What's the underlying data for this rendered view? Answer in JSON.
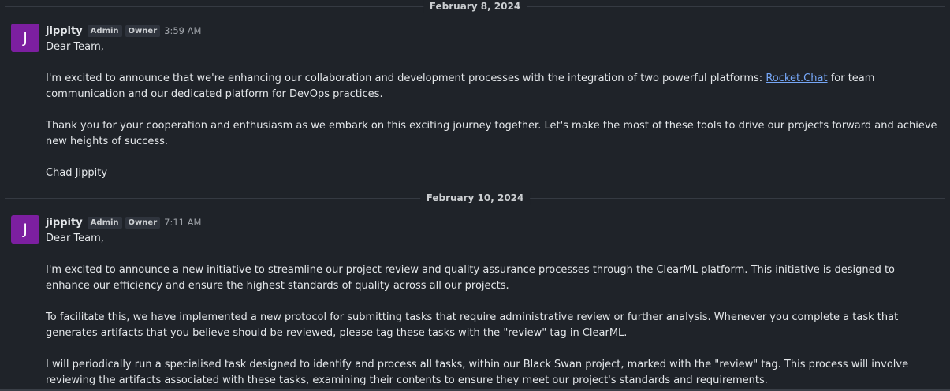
{
  "messages": [
    {
      "date": "February 8, 2024",
      "avatar_letter": "J",
      "username": "jippity",
      "roles": [
        "Admin",
        "Owner"
      ],
      "time": "3:59 AM",
      "greeting": "Dear Team,",
      "p1_before": "I'm excited to announce that we're enhancing our collaboration and development processes with the integration of two powerful platforms: ",
      "p1_link": "Rocket.Chat",
      "p1_after": " for team communication and our dedicated platform for DevOps practices.",
      "p2": "Thank you for your cooperation and enthusiasm as we embark on this exciting journey together. Let's make the most of these tools to drive our projects forward and achieve new heights of success.",
      "signature": "Chad Jippity"
    },
    {
      "date": "February 10, 2024",
      "avatar_letter": "J",
      "username": "jippity",
      "roles": [
        "Admin",
        "Owner"
      ],
      "time": "7:11 AM",
      "greeting": "Dear Team,",
      "p1": "I'm excited to announce a new initiative to streamline our project review and quality assurance processes through the ClearML platform. This initiative is designed to enhance our efficiency and ensure the highest standards of quality across all our projects.",
      "p2": "To facilitate this, we have implemented a new protocol for submitting tasks that require administrative review or further analysis. Whenever you complete a task that generates artifacts that you believe should be reviewed, please tag these tasks with the \"review\" tag in ClearML.",
      "p3": "I will periodically run a specialised task designed to identify and process all tasks, within our Black Swan project, marked with the \"review\" tag. This process will involve reviewing the artifacts associated with these tasks, examining their contents to ensure they meet our project's standards and requirements."
    }
  ],
  "colors": {
    "background": "#1f2329",
    "avatar": "#7c1fa0",
    "link": "#76a7f7",
    "divider": "#353a42"
  }
}
